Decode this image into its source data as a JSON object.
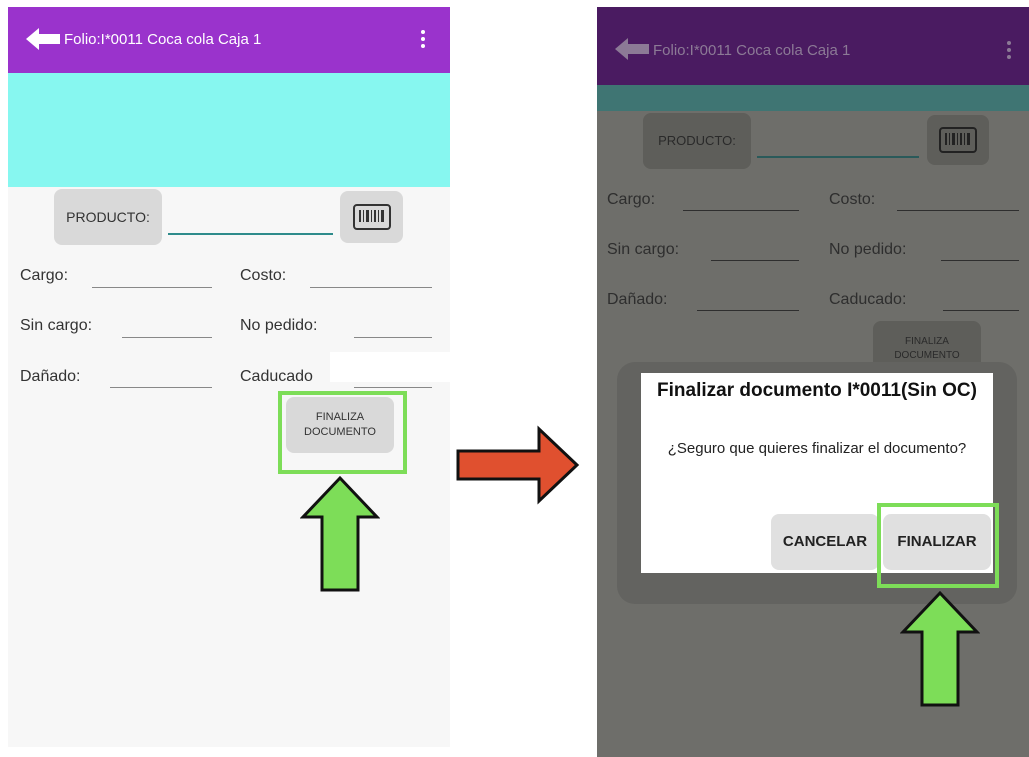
{
  "left_screen": {
    "header": {
      "title": "Folio:I*0011 Coca cola Caja 1"
    },
    "product_button": "PRODUCTO:",
    "fields": [
      {
        "label": "Cargo:"
      },
      {
        "label": "Costo:"
      },
      {
        "label": "Sin cargo:"
      },
      {
        "label": "No pedido:"
      },
      {
        "label": "Dañado:"
      },
      {
        "label": "Caducado"
      }
    ],
    "finalize_button": {
      "line1": "FINALIZA",
      "line2": "DOCUMENTO"
    }
  },
  "right_screen": {
    "header": {
      "title": "Folio:I*0011 Coca cola Caja 1"
    },
    "product_button": "PRODUCTO:",
    "fields": [
      {
        "label": "Cargo:"
      },
      {
        "label": "Costo:"
      },
      {
        "label": "Sin cargo:"
      },
      {
        "label": "No pedido:"
      },
      {
        "label": "Dañado:"
      },
      {
        "label": "Caducado:"
      }
    ],
    "finalize_button": {
      "line1": "FINALIZA",
      "line2": "DOCUMENTO"
    },
    "dialog": {
      "title": "Finalizar documento I*0011(Sin OC)",
      "message": "¿Seguro que quieres finalizar el documento?",
      "cancel_label": "CANCELAR",
      "confirm_label": "FINALIZAR"
    }
  },
  "colors": {
    "header": "#9a33cc",
    "banner": "#87f7f0",
    "underline_accent": "#2e8b8b",
    "highlight": "#7ddd58",
    "arrow_red": "#e0502f",
    "overlay": "#6e6e6a"
  }
}
